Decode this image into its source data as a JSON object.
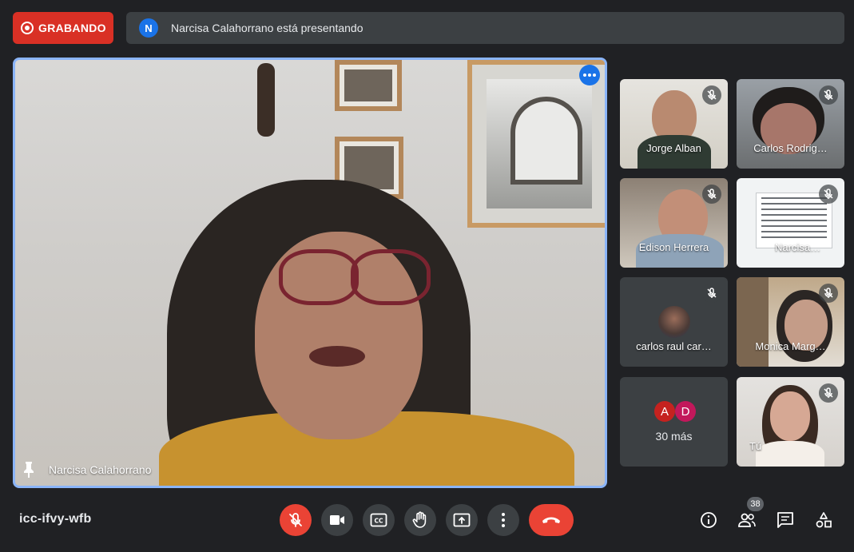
{
  "recording": {
    "label": "GRABANDO",
    "color": "#d93025"
  },
  "presenting": {
    "initial": "N",
    "text": "Narcisa Calahorrano está presentando"
  },
  "main_tile": {
    "name": "Narcisa Calahorrano",
    "highlight_color": "#8ab4f8"
  },
  "participants": [
    {
      "name": "Jorge Alban",
      "muted": true
    },
    {
      "name": "Carlos Rodrig…",
      "muted": true
    },
    {
      "name": "Edison Herrera",
      "muted": true
    },
    {
      "name": "Narcisa…",
      "muted": true
    },
    {
      "name": "carlos raul car…",
      "muted": true
    },
    {
      "name": "Monica Marg…",
      "muted": true
    },
    {
      "name": "Tú",
      "muted": true
    }
  ],
  "others": {
    "avatars": [
      {
        "letter": "A",
        "color": "#c5221f"
      },
      {
        "letter": "D",
        "color": "#c2185b"
      }
    ],
    "count_label": "30 más"
  },
  "meeting_code": "icc-ifvy-wfb",
  "participant_count": "38",
  "icons": {
    "mic": "mic-off-icon",
    "camera": "videocam-icon",
    "captions": "closed-caption-icon",
    "hand": "raise-hand-icon",
    "present": "present-screen-icon",
    "more": "more-vert-icon",
    "end": "call-end-icon",
    "info": "info-icon",
    "people": "people-icon",
    "chat": "chat-icon",
    "activities": "activities-icon"
  }
}
